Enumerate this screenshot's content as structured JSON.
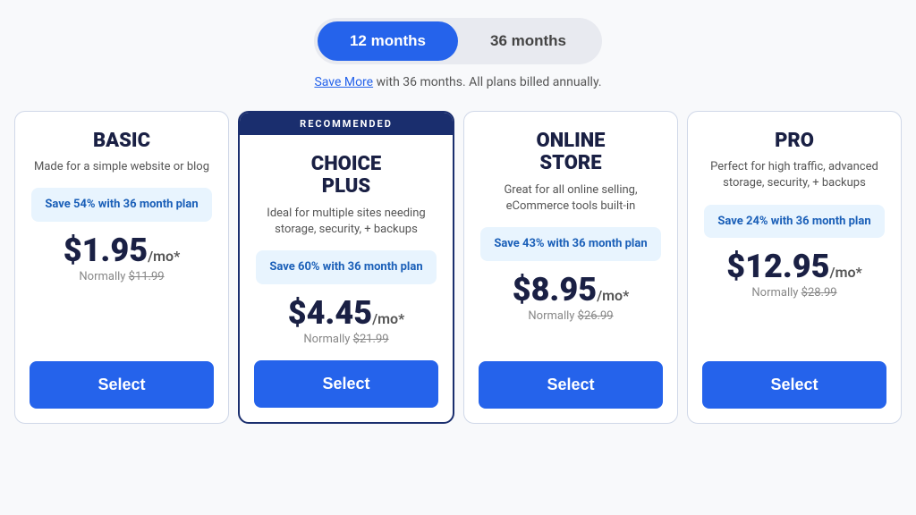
{
  "toggle": {
    "option1": "12 months",
    "option2": "36 months",
    "active": "12 months"
  },
  "subtitle": {
    "link_text": "Save More",
    "rest_text": " with 36 months. All plans billed annually."
  },
  "plans": [
    {
      "id": "basic",
      "name": "BASIC",
      "desc": "Made for a simple website or blog",
      "save_badge": "Save 54% with 36 month plan",
      "price": "$1.95",
      "price_suffix": "/mo*",
      "normal_label": "Normally ",
      "normal_price": "$11.99",
      "recommended": false,
      "select_label": "Select"
    },
    {
      "id": "choice-plus",
      "name": "CHOICE\nPLUS",
      "desc": "Ideal for multiple sites needing storage, security, + backups",
      "save_badge": "Save 60% with 36 month plan",
      "price": "$4.45",
      "price_suffix": "/mo*",
      "normal_label": "Normally ",
      "normal_price": "$21.99",
      "recommended": true,
      "recommended_label": "RECOMMENDED",
      "select_label": "Select"
    },
    {
      "id": "online-store",
      "name": "ONLINE\nSTORE",
      "desc": "Great for all online selling, eCommerce tools built-in",
      "save_badge": "Save 43% with 36 month plan",
      "price": "$8.95",
      "price_suffix": "/mo*",
      "normal_label": "Normally ",
      "normal_price": "$26.99",
      "recommended": false,
      "select_label": "Select"
    },
    {
      "id": "pro",
      "name": "PRO",
      "desc": "Perfect for high traffic, advanced storage, security, + backups",
      "save_badge": "Save 24% with 36 month plan",
      "price": "$12.95",
      "price_suffix": "/mo*",
      "normal_label": "Normally ",
      "normal_price": "$28.99",
      "recommended": false,
      "select_label": "Select"
    }
  ]
}
